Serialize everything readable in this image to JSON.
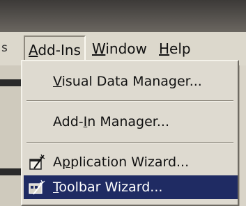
{
  "menubar": {
    "edge_char": "s",
    "menus": [
      {
        "key": "A",
        "rest": "dd-Ins"
      },
      {
        "key": "W",
        "rest": "indow"
      },
      {
        "key": "H",
        "rest": "elp"
      }
    ]
  },
  "dropdown": {
    "items": [
      {
        "key": "V",
        "rest": "isual Data Manager..."
      },
      {
        "pre": "Add-",
        "key": "I",
        "rest": "n Manager..."
      },
      {
        "pre": "A",
        "key": "p",
        "rest": "plication Wizard...",
        "icon": "application-wizard-icon"
      },
      {
        "key": "T",
        "rest": "oolbar Wizard...",
        "icon": "toolbar-wizard-icon",
        "highlighted": true
      }
    ]
  },
  "colors": {
    "menu_background": "#dedad0",
    "highlight": "#1f2b63",
    "highlight_text": "#ffffff"
  }
}
